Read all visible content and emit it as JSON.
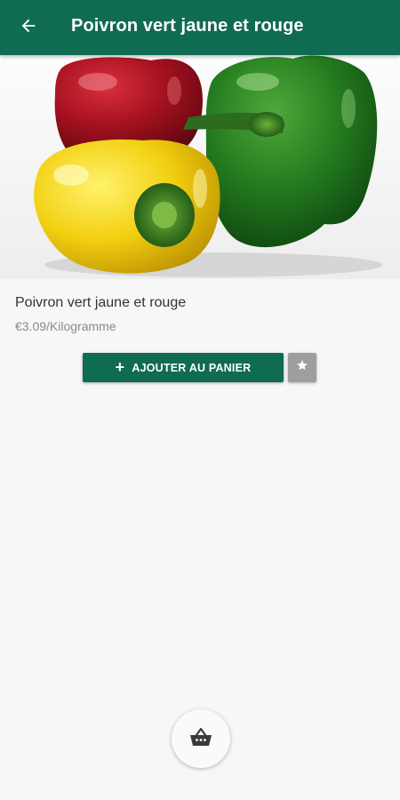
{
  "appbar": {
    "title": "Poivron vert jaune et rouge",
    "back_icon": "arrow-left-icon"
  },
  "product": {
    "name": "Poivron vert jaune et rouge",
    "price": "€3.09/Kilogramme",
    "image_icon": "bell-peppers-photo"
  },
  "actions": {
    "add_to_cart_label": "AJOUTER AU PANIER",
    "add_icon": "plus-icon",
    "favorite_icon": "star-icon"
  },
  "cart": {
    "icon": "basket-icon"
  },
  "colors": {
    "primary": "#0f6b52",
    "background": "#f7f7f7",
    "favorite_button": "#9e9e9e"
  }
}
